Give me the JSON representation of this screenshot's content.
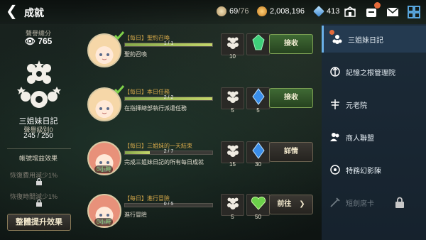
{
  "header": {
    "title": "成就",
    "stamina": {
      "current": "69",
      "max": "/76"
    },
    "coins": "2,008,196",
    "gems": "413"
  },
  "left_panel": {
    "reputation_label": "聲譽總分",
    "reputation_value": "765",
    "sister_name": "三姐妹日記",
    "rep_level": "聲譽級別0",
    "rep_progress": "245 / 250",
    "bonus_title": "帳號增益效果",
    "bonus_items": [
      "恢復費用減少1%",
      "恢復時間減少1%"
    ],
    "overall_button": "整體提升效果"
  },
  "quests": [
    {
      "title": "【每日】聖約召喚",
      "progress_text": "1 / 1",
      "progress": 1.0,
      "description": "聖約召喚",
      "rewards": [
        {
          "icon": "token-icon",
          "count": "10"
        },
        {
          "icon": "green-crystal-icon",
          "count": ""
        }
      ],
      "action": "接收",
      "action_style": "green",
      "completed": true,
      "tag": ""
    },
    {
      "title": "【每日】本日任務",
      "progress_text": "2 / 2",
      "progress": 1.0,
      "description": "在指揮總部執行派遣任務",
      "rewards": [
        {
          "icon": "token-icon",
          "count": "5"
        },
        {
          "icon": "blue-crystal-icon",
          "count": "5"
        }
      ],
      "action": "接收",
      "action_style": "green",
      "completed": true,
      "tag": ""
    },
    {
      "title": "【每日】三姐妹的一天結束",
      "progress_text": "2 / 7",
      "progress": 0.2857,
      "description": "完成三姐妹日記的所有每日成就",
      "rewards": [
        {
          "icon": "token-icon",
          "count": "15"
        },
        {
          "icon": "blue-crystal-icon",
          "count": "30"
        }
      ],
      "action": "詳情",
      "action_style": "dark",
      "completed": false,
      "tag": "0小時"
    },
    {
      "title": "【每日】進行冒險",
      "progress_text": "0 / 5",
      "progress": 0.0,
      "description": "進行冒險",
      "rewards": [
        {
          "icon": "token-icon",
          "count": "5"
        },
        {
          "icon": "green-heart-gem-icon",
          "count": "50"
        }
      ],
      "action": "前往",
      "action_style": "dark",
      "completed": false,
      "tag": "0小時"
    }
  ],
  "sidebar": {
    "tabs": [
      {
        "label": "三姐妹日記",
        "active": true,
        "disabled": false,
        "notif": true
      },
      {
        "label": "記憶之根管理院",
        "active": false,
        "disabled": false,
        "notif": false
      },
      {
        "label": "元老院",
        "active": false,
        "disabled": false,
        "notif": false
      },
      {
        "label": "商人聯盟",
        "active": false,
        "disabled": false,
        "notif": false
      },
      {
        "label": "特務幻影陳",
        "active": false,
        "disabled": false,
        "notif": false
      },
      {
        "label": "短劍席卡",
        "active": false,
        "disabled": true,
        "notif": false
      }
    ]
  },
  "colors": {
    "accent_gold": "#d6a94a",
    "button_green": "#3f6a34",
    "sidebar_active": "#243a50"
  }
}
